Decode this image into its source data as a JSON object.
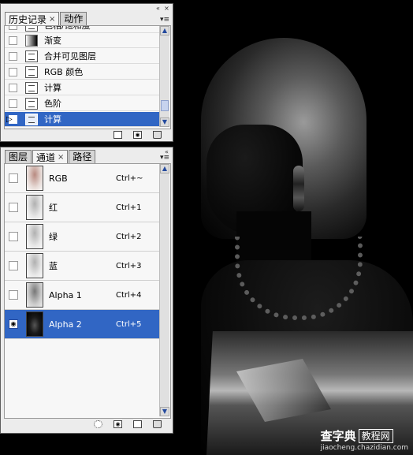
{
  "watermark": {
    "site": "查字典",
    "box": "教程网",
    "url": "jiaocheng.chazidian.com"
  },
  "history_panel": {
    "tabs": [
      {
        "label": "历史记录",
        "active": true,
        "closable": true
      },
      {
        "label": "动作",
        "active": false,
        "closable": false
      }
    ],
    "items": [
      {
        "label": "色相/饱和度",
        "icon": "doc-icon",
        "selected": false
      },
      {
        "label": "渐变",
        "icon": "gradient-icon",
        "selected": false
      },
      {
        "label": "合并可见图层",
        "icon": "doc-icon",
        "selected": false
      },
      {
        "label": "RGB 颜色",
        "icon": "doc-icon",
        "selected": false
      },
      {
        "label": "计算",
        "icon": "doc-icon",
        "selected": false
      },
      {
        "label": "色阶",
        "icon": "doc-icon",
        "selected": false
      },
      {
        "label": "计算",
        "icon": "doc-icon",
        "selected": true
      }
    ],
    "scroll_position": 0.85
  },
  "channels_panel": {
    "tabs": [
      {
        "label": "图层",
        "active": false,
        "closable": false
      },
      {
        "label": "通道",
        "active": true,
        "closable": true
      },
      {
        "label": "路径",
        "active": false,
        "closable": false
      }
    ],
    "channels": [
      {
        "name": "RGB",
        "shortcut": "Ctrl+~",
        "visible": false,
        "selected": false,
        "thumb": "rgb"
      },
      {
        "name": "红",
        "shortcut": "Ctrl+1",
        "visible": false,
        "selected": false,
        "thumb": "gray"
      },
      {
        "name": "绿",
        "shortcut": "Ctrl+2",
        "visible": false,
        "selected": false,
        "thumb": "gray"
      },
      {
        "name": "蓝",
        "shortcut": "Ctrl+3",
        "visible": false,
        "selected": false,
        "thumb": "gray"
      },
      {
        "name": "Alpha 1",
        "shortcut": "Ctrl+4",
        "visible": false,
        "selected": false,
        "thumb": "mid"
      },
      {
        "name": "Alpha 2",
        "shortcut": "Ctrl+5",
        "visible": true,
        "selected": true,
        "thumb": "dark"
      }
    ]
  },
  "colors": {
    "selection": "#3166c4",
    "panel_bg": "#ececec"
  }
}
